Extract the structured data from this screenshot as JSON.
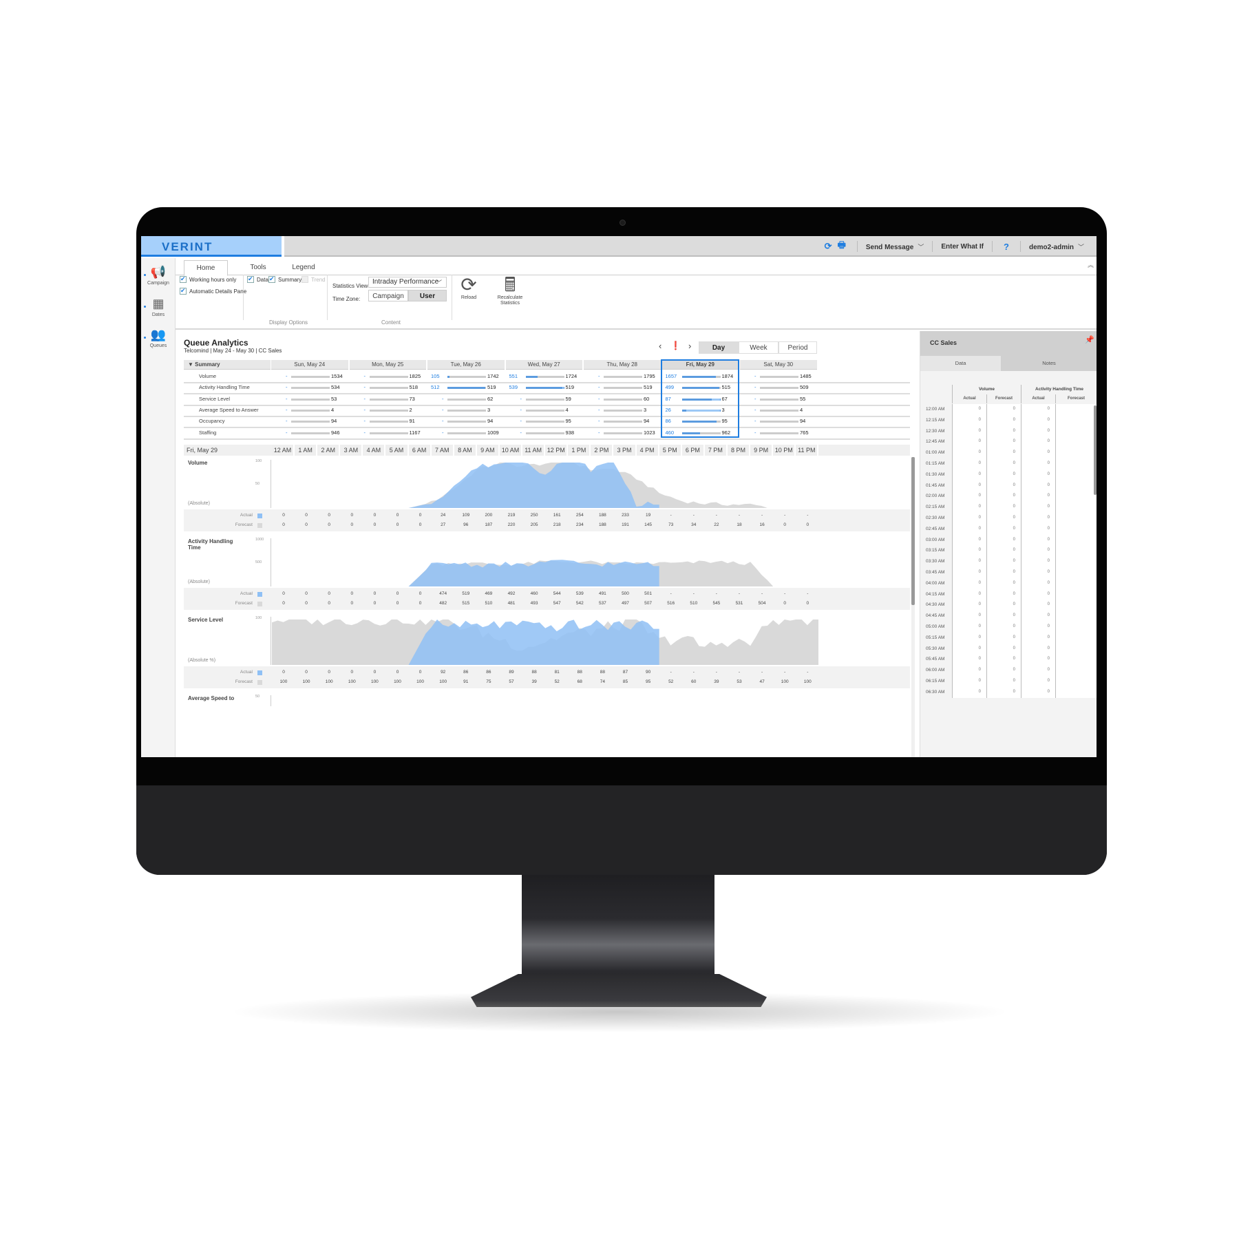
{
  "app": {
    "brand": "VERINT",
    "header_actions": {
      "refresh_icon": "refresh-icon",
      "print_icon": "print-icon",
      "send_message": "Send Message",
      "enter_what_if": "Enter What If",
      "help": "?",
      "user": "demo2-admin"
    }
  },
  "sidebar": {
    "items": [
      {
        "label": "Campaign",
        "icon": "megaphone-icon"
      },
      {
        "label": "Dates",
        "icon": "calendar-icon"
      },
      {
        "label": "Queues",
        "icon": "people-icon"
      }
    ]
  },
  "ribbon": {
    "tabs": [
      "Home",
      "Tools",
      "Legend"
    ],
    "active_tab": "Home",
    "options": {
      "working_hours_only": {
        "label": "Working hours only",
        "checked": true
      },
      "automatic_details_pane": {
        "label": "Automatic Details Pane",
        "checked": true
      },
      "data": {
        "label": "Data",
        "checked": true
      },
      "summary": {
        "label": "Summary",
        "checked": true
      },
      "trend": {
        "label": "Trend",
        "checked": false,
        "disabled": true
      }
    },
    "display_options_label": "Display Options",
    "statistics_view_label": "Statistics View:",
    "statistics_view_value": "Intraday Performance",
    "time_zone_label": "Time Zone:",
    "time_zone_options": [
      "Campaign",
      "User"
    ],
    "time_zone_selected": "User",
    "content_label": "Content",
    "reload_label": "Reload",
    "recalculate_label": "Recalculate Statistics"
  },
  "main": {
    "title": "Queue Analytics",
    "subtitle": "Telcomind | May 24 - May 30 | CC Sales",
    "period_options": [
      "Day",
      "Week",
      "Period"
    ],
    "period_selected": "Day",
    "summary": {
      "header": "Summary",
      "days": [
        "Sun, May 24",
        "Mon, May 25",
        "Tue, May 26",
        "Wed, May 27",
        "Thu, May 28",
        "Fri, May 29",
        "Sat, May 30"
      ],
      "selected_day_index": 5,
      "rows": [
        {
          "label": "Volume",
          "actual": [
            "-",
            "-",
            "105",
            "551",
            "-",
            "1657",
            "-"
          ],
          "forecast": [
            "1534",
            "1825",
            "1742",
            "1724",
            "1795",
            "1874",
            "1485"
          ]
        },
        {
          "label": "Activity Handling Time",
          "actual": [
            "-",
            "-",
            "512",
            "539",
            "-",
            "499",
            "-"
          ],
          "forecast": [
            "534",
            "518",
            "519",
            "519",
            "519",
            "515",
            "509"
          ]
        },
        {
          "label": "Service Level",
          "actual": [
            "-",
            "-",
            "-",
            "-",
            "-",
            "87",
            "-"
          ],
          "forecast": [
            "53",
            "73",
            "62",
            "59",
            "60",
            "67",
            "55"
          ]
        },
        {
          "label": "Average Speed to Answer",
          "actual": [
            "-",
            "-",
            "-",
            "-",
            "-",
            "26",
            "-"
          ],
          "forecast": [
            "4",
            "2",
            "3",
            "4",
            "3",
            "3",
            "4"
          ]
        },
        {
          "label": "Occupancy",
          "actual": [
            "-",
            "-",
            "-",
            "-",
            "-",
            "86",
            "-"
          ],
          "forecast": [
            "94",
            "91",
            "94",
            "95",
            "94",
            "95",
            "94"
          ]
        },
        {
          "label": "Staffing",
          "actual": [
            "-",
            "-",
            "-",
            "-",
            "-",
            "460",
            "-"
          ],
          "forecast": [
            "946",
            "1167",
            "1009",
            "938",
            "1023",
            "962",
            "765"
          ]
        }
      ]
    },
    "intraday": {
      "day_label": "Fri, May 29",
      "hours": [
        "12 AM",
        "1 AM",
        "2 AM",
        "3 AM",
        "4 AM",
        "5 AM",
        "6 AM",
        "7 AM",
        "8 AM",
        "9 AM",
        "10 AM",
        "11 AM",
        "12 PM",
        "1 PM",
        "2 PM",
        "3 PM",
        "4 PM",
        "5 PM",
        "6 PM",
        "7 PM",
        "8 PM",
        "9 PM",
        "10 PM",
        "11 PM"
      ],
      "actual_label": "Actual",
      "forecast_label": "Forecast"
    }
  },
  "chart_data": [
    {
      "type": "area",
      "title": "Volume",
      "ylabel": "(Absolute)",
      "yticks": [
        "100",
        "50"
      ],
      "ylim": [
        0,
        100
      ],
      "x": [
        "12 AM",
        "1 AM",
        "2 AM",
        "3 AM",
        "4 AM",
        "5 AM",
        "6 AM",
        "7 AM",
        "8 AM",
        "9 AM",
        "10 AM",
        "11 AM",
        "12 PM",
        "1 PM",
        "2 PM",
        "3 PM",
        "4 PM",
        "5 PM",
        "6 PM",
        "7 PM",
        "8 PM",
        "9 PM",
        "10 PM",
        "11 PM"
      ],
      "series": [
        {
          "name": "Actual",
          "color": "#8fc0f5",
          "values": [
            "0",
            "0",
            "0",
            "0",
            "0",
            "0",
            "0",
            "24",
            "109",
            "200",
            "219",
            "250",
            "161",
            "254",
            "188",
            "233",
            "19",
            "-",
            "-",
            "-",
            "-",
            "-",
            "-",
            "-"
          ]
        },
        {
          "name": "Forecast",
          "color": "#d9d9d9",
          "values": [
            "0",
            "0",
            "0",
            "0",
            "0",
            "0",
            "0",
            "27",
            "96",
            "187",
            "220",
            "205",
            "218",
            "234",
            "188",
            "191",
            "145",
            "73",
            "34",
            "22",
            "18",
            "16",
            "0",
            "0"
          ]
        }
      ]
    },
    {
      "type": "area",
      "title": "Activity Handling Time",
      "ylabel": "(Absolute)",
      "yticks": [
        "1000",
        "500"
      ],
      "ylim": [
        0,
        1000
      ],
      "x": [
        "12 AM",
        "1 AM",
        "2 AM",
        "3 AM",
        "4 AM",
        "5 AM",
        "6 AM",
        "7 AM",
        "8 AM",
        "9 AM",
        "10 AM",
        "11 AM",
        "12 PM",
        "1 PM",
        "2 PM",
        "3 PM",
        "4 PM",
        "5 PM",
        "6 PM",
        "7 PM",
        "8 PM",
        "9 PM",
        "10 PM",
        "11 PM"
      ],
      "series": [
        {
          "name": "Actual",
          "color": "#8fc0f5",
          "values": [
            "0",
            "0",
            "0",
            "0",
            "0",
            "0",
            "0",
            "474",
            "519",
            "469",
            "492",
            "460",
            "544",
            "539",
            "491",
            "500",
            "501",
            "-",
            "-",
            "-",
            "-",
            "-",
            "-",
            "-"
          ]
        },
        {
          "name": "Forecast",
          "color": "#d9d9d9",
          "values": [
            "0",
            "0",
            "0",
            "0",
            "0",
            "0",
            "0",
            "482",
            "515",
            "510",
            "481",
            "493",
            "547",
            "542",
            "537",
            "497",
            "507",
            "516",
            "510",
            "545",
            "531",
            "504",
            "0",
            "0"
          ]
        }
      ]
    },
    {
      "type": "area",
      "title": "Service Level",
      "ylabel": "(Absolute %)",
      "yticks": [
        "100"
      ],
      "ylim": [
        0,
        100
      ],
      "x": [
        "12 AM",
        "1 AM",
        "2 AM",
        "3 AM",
        "4 AM",
        "5 AM",
        "6 AM",
        "7 AM",
        "8 AM",
        "9 AM",
        "10 AM",
        "11 AM",
        "12 PM",
        "1 PM",
        "2 PM",
        "3 PM",
        "4 PM",
        "5 PM",
        "6 PM",
        "7 PM",
        "8 PM",
        "9 PM",
        "10 PM",
        "11 PM"
      ],
      "series": [
        {
          "name": "Actual",
          "color": "#8fc0f5",
          "values": [
            "0",
            "0",
            "0",
            "0",
            "0",
            "0",
            "0",
            "92",
            "86",
            "86",
            "89",
            "88",
            "81",
            "88",
            "88",
            "87",
            "90",
            "-",
            "-",
            "-",
            "-",
            "-",
            "-",
            "-"
          ]
        },
        {
          "name": "Forecast",
          "color": "#d9d9d9",
          "values": [
            "100",
            "100",
            "100",
            "100",
            "100",
            "100",
            "100",
            "100",
            "91",
            "75",
            "57",
            "39",
            "52",
            "68",
            "74",
            "85",
            "95",
            "52",
            "60",
            "39",
            "53",
            "47",
            "100",
            "100"
          ]
        }
      ]
    },
    {
      "type": "area",
      "title": "Average Speed to",
      "yticks": [
        "50"
      ],
      "ylim": [
        0,
        50
      ],
      "series": []
    }
  ],
  "details_pane": {
    "title": "CC Sales",
    "tabs": [
      "Data",
      "Notes"
    ],
    "active_tab": "Data",
    "groups": [
      "Volume",
      "Activity Handling Time"
    ],
    "subcols": [
      "Actual",
      "Forecast",
      "Actual",
      "Forecast"
    ],
    "rows": [
      {
        "time": "12:00 AM",
        "values": [
          "0",
          "0",
          "0"
        ]
      },
      {
        "time": "12:15 AM",
        "values": [
          "0",
          "0",
          "0"
        ]
      },
      {
        "time": "12:30 AM",
        "values": [
          "0",
          "0",
          "0"
        ]
      },
      {
        "time": "12:45 AM",
        "values": [
          "0",
          "0",
          "0"
        ]
      },
      {
        "time": "01:00 AM",
        "values": [
          "0",
          "0",
          "0"
        ]
      },
      {
        "time": "01:15 AM",
        "values": [
          "0",
          "0",
          "0"
        ]
      },
      {
        "time": "01:30 AM",
        "values": [
          "0",
          "0",
          "0"
        ]
      },
      {
        "time": "01:45 AM",
        "values": [
          "0",
          "0",
          "0"
        ]
      },
      {
        "time": "02:00 AM",
        "values": [
          "0",
          "0",
          "0"
        ]
      },
      {
        "time": "02:15 AM",
        "values": [
          "0",
          "0",
          "0"
        ]
      },
      {
        "time": "02:30 AM",
        "values": [
          "0",
          "0",
          "0"
        ]
      },
      {
        "time": "02:45 AM",
        "values": [
          "0",
          "0",
          "0"
        ]
      },
      {
        "time": "03:00 AM",
        "values": [
          "0",
          "0",
          "0"
        ]
      },
      {
        "time": "03:15 AM",
        "values": [
          "0",
          "0",
          "0"
        ]
      },
      {
        "time": "03:30 AM",
        "values": [
          "0",
          "0",
          "0"
        ]
      },
      {
        "time": "03:45 AM",
        "values": [
          "0",
          "0",
          "0"
        ]
      },
      {
        "time": "04:00 AM",
        "values": [
          "0",
          "0",
          "0"
        ]
      },
      {
        "time": "04:15 AM",
        "values": [
          "0",
          "0",
          "0"
        ]
      },
      {
        "time": "04:30 AM",
        "values": [
          "0",
          "0",
          "0"
        ]
      },
      {
        "time": "04:45 AM",
        "values": [
          "0",
          "0",
          "0"
        ]
      },
      {
        "time": "05:00 AM",
        "values": [
          "0",
          "0",
          "0"
        ]
      },
      {
        "time": "05:15 AM",
        "values": [
          "0",
          "0",
          "0"
        ]
      },
      {
        "time": "05:30 AM",
        "values": [
          "0",
          "0",
          "0"
        ]
      },
      {
        "time": "05:45 AM",
        "values": [
          "0",
          "0",
          "0"
        ]
      },
      {
        "time": "06:00 AM",
        "values": [
          "0",
          "0",
          "0"
        ]
      },
      {
        "time": "06:15 AM",
        "values": [
          "0",
          "0",
          "0"
        ]
      },
      {
        "time": "06:30 AM",
        "values": [
          "0",
          "0",
          "0"
        ]
      }
    ]
  },
  "colors": {
    "accent": "#1e7de0",
    "brand_bg": "#a6d0fb",
    "actual": "#8fc0f5",
    "actual_overlap": "#96badf",
    "forecast": "#d9d9d9"
  }
}
